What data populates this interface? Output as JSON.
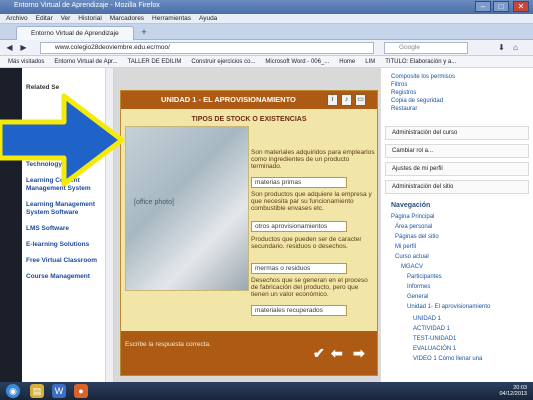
{
  "window": {
    "title": "Entorno Virtual de Aprendizaje - Mozilla Firefox",
    "minimize": "–",
    "maximize": "□",
    "close": "✕"
  },
  "menu": [
    "Archivo",
    "Editar",
    "Ver",
    "Historial",
    "Marcadores",
    "Herramientas",
    "Ayuda"
  ],
  "tab": {
    "label": "Entorno Virtual de Aprendizaje",
    "new_tab": "+"
  },
  "nav": {
    "back": "◀",
    "forward": "▶",
    "url": "www.colegio28deoviembre.edu.ec/moo/",
    "search_placeholder": "Google",
    "home": "⌂",
    "download": "⬇"
  },
  "bookmarks": [
    "Más visitados",
    "Entorno Virtual de Apr...",
    "TALLER DE EDILIM",
    "Construir ejercicios co...",
    "Microsoft Word - 006_...",
    "Home",
    "LIM",
    "TITULO: Elaboración y a..."
  ],
  "leftnav": {
    "title": "Related Se",
    "links": [
      "Technology Program",
      "Learning Content Management System",
      "Learning Management System Software",
      "LMS Software",
      "E-learning Solutions",
      "Free Virtual Classroom",
      "Course Management"
    ]
  },
  "lesson": {
    "header": "UNIDAD 1 - EL APROVISIONAMIENTO",
    "subtitle": "TIPOS DE STOCK O EXISTENCIAS",
    "photo_placeholder": "[office photo]",
    "items": [
      {
        "desc": "Son materiales adquiridos para emplearlos como ingredientes de un producto terminado.",
        "answer": "materias primas"
      },
      {
        "desc": "Son productos que adquiere la empresa y que necesita par su funcionamiento combustible envases etc.",
        "answer": "otros aprovisionamientos"
      },
      {
        "desc": "Productos que pueden ser de caracter secundario. residuos o desechos.",
        "answer": "mermas o residuos"
      },
      {
        "desc": "Desechos que se generan en el proceso de fabricación del producto, pero que tienen un valor económico.",
        "answer": "materiales recuperados"
      }
    ],
    "instruction": "Escribe la respuesta correcta.",
    "check": "✔",
    "back": "⬅",
    "next": "➡"
  },
  "rightcol": {
    "top_items": [
      "Composite los permisos",
      "Filtros",
      "Registros",
      "Copia de seguridad",
      "Restaurar"
    ],
    "blocks": [
      "Administración del curso",
      "Cambiar rol a...",
      "Ajustes de mi perfil",
      "Administración del sitio"
    ],
    "nav_title": "Navegación",
    "nav_items": [
      "Página Principal",
      "Área personal",
      "Páginas del sitio",
      "Mi perfil",
      "Curso actual",
      "MGACV",
      "Participantes",
      "Informes",
      "General",
      "Unidad 1- El aprovisionamiento",
      "UNIDAD 1",
      "ACTIVIDAD 1",
      "TEST-UNIDAD1",
      "EVALUACIÓN 1",
      "VIDEO 1 Cómo llenar una"
    ]
  },
  "taskbar": {
    "clock_time": "20:03",
    "clock_date": "04/12/2013"
  },
  "colors": {
    "header": "#ad5a14",
    "lesson_bg": "#f1e6a7",
    "arrow_fill": "#1f63c9",
    "arrow_outline": "#f5e90a"
  }
}
